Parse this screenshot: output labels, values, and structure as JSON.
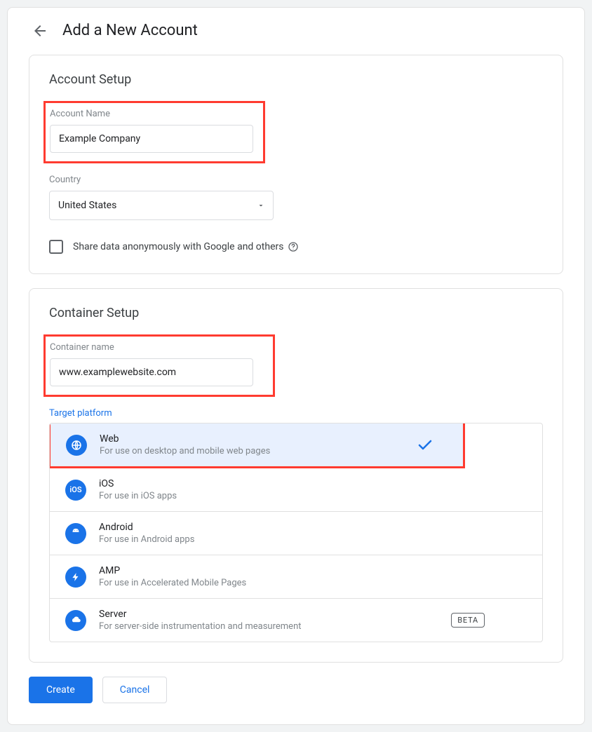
{
  "header": {
    "title": "Add a New Account"
  },
  "account_setup": {
    "title": "Account Setup",
    "account_name_label": "Account Name",
    "account_name_value": "Example Company",
    "country_label": "Country",
    "country_value": "United States",
    "share_label": "Share data anonymously with Google and others",
    "share_checked": false
  },
  "container_setup": {
    "title": "Container Setup",
    "container_name_label": "Container name",
    "container_name_value": "www.examplewebsite.com",
    "target_platform_label": "Target platform",
    "platforms": [
      {
        "icon": "globe",
        "name": "Web",
        "desc": "For use on desktop and mobile web pages",
        "selected": true
      },
      {
        "icon": "ios",
        "name": "iOS",
        "desc": "For use in iOS apps",
        "selected": false
      },
      {
        "icon": "android",
        "name": "Android",
        "desc": "For use in Android apps",
        "selected": false
      },
      {
        "icon": "amp",
        "name": "AMP",
        "desc": "For use in Accelerated Mobile Pages",
        "selected": false
      },
      {
        "icon": "server",
        "name": "Server",
        "desc": "For server-side instrumentation and measurement",
        "selected": false,
        "badge": "BETA"
      }
    ]
  },
  "actions": {
    "create": "Create",
    "cancel": "Cancel"
  }
}
